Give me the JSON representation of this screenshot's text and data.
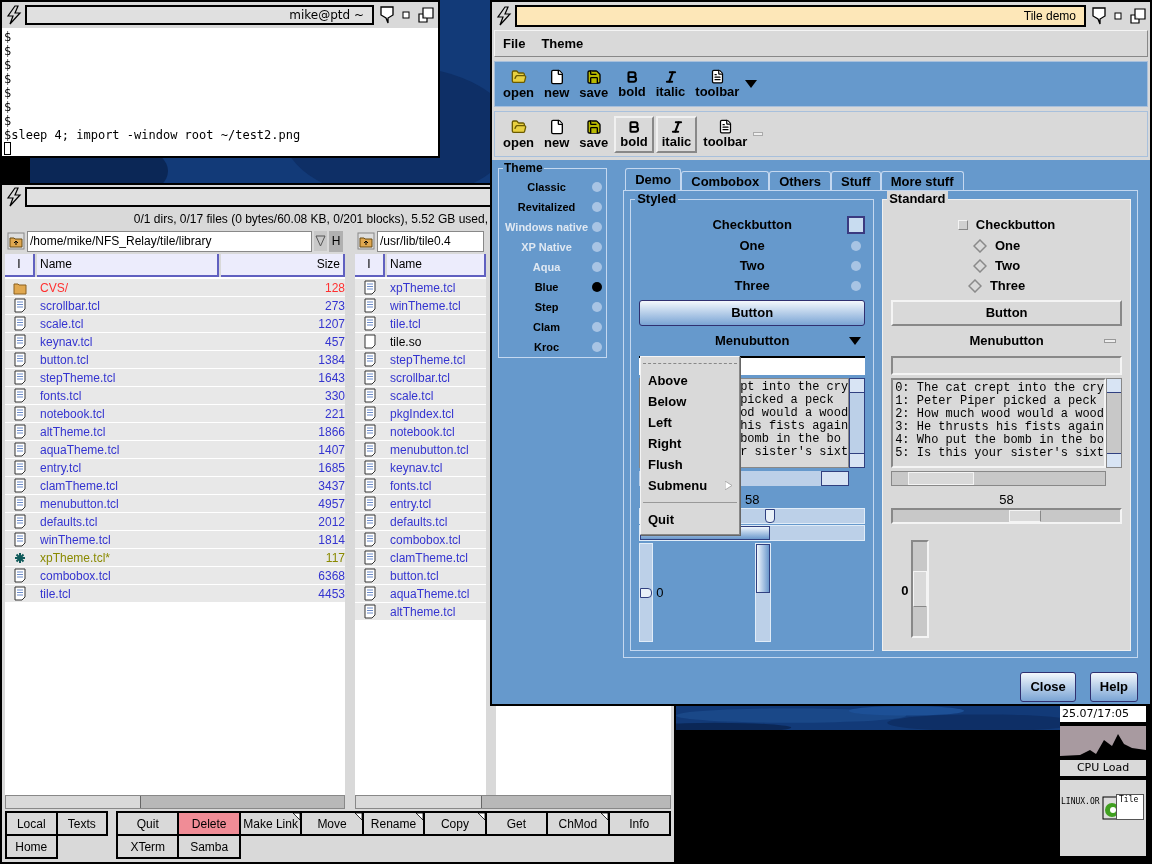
{
  "terminal": {
    "title": "mike@ptd ~",
    "lines": [
      "$",
      "$",
      "$",
      "$",
      "$",
      "$",
      "$",
      "$sleep 4; import -window root ~/test2.png"
    ]
  },
  "file_manager": {
    "status": "0/1 dirs, 0/17 files (0 bytes/60.08 KB, 0/201 blocks), 5.52 GB used,",
    "panes": [
      {
        "path": "/home/mike/NFS_Relay/tile/library",
        "history_button": "H",
        "columns": [
          "I",
          "Name",
          "Size"
        ],
        "files": [
          {
            "name": "CVS/",
            "size": "128",
            "kind": "folder"
          },
          {
            "name": "scrollbar.tcl",
            "size": "273",
            "kind": "file"
          },
          {
            "name": "scale.tcl",
            "size": "1207",
            "kind": "file"
          },
          {
            "name": "keynav.tcl",
            "size": "457",
            "kind": "file"
          },
          {
            "name": "button.tcl",
            "size": "1384",
            "kind": "file"
          },
          {
            "name": "stepTheme.tcl",
            "size": "1643",
            "kind": "file"
          },
          {
            "name": "fonts.tcl",
            "size": "330",
            "kind": "file"
          },
          {
            "name": "notebook.tcl",
            "size": "221",
            "kind": "file"
          },
          {
            "name": "altTheme.tcl",
            "size": "1866",
            "kind": "file"
          },
          {
            "name": "aquaTheme.tcl",
            "size": "1407",
            "kind": "file"
          },
          {
            "name": "entry.tcl",
            "size": "1685",
            "kind": "file"
          },
          {
            "name": "clamTheme.tcl",
            "size": "3437",
            "kind": "file"
          },
          {
            "name": "menubutton.tcl",
            "size": "4957",
            "kind": "file"
          },
          {
            "name": "defaults.tcl",
            "size": "2012",
            "kind": "file"
          },
          {
            "name": "winTheme.tcl",
            "size": "1814",
            "kind": "file"
          },
          {
            "name": "xpTheme.tcl*",
            "size": "117",
            "kind": "modified"
          },
          {
            "name": "combobox.tcl",
            "size": "6368",
            "kind": "file"
          },
          {
            "name": "tile.tcl",
            "size": "4453",
            "kind": "file"
          }
        ]
      },
      {
        "path": "/usr/lib/tile0.4",
        "columns": [
          "I",
          "Name"
        ],
        "files": [
          {
            "name": "xpTheme.tcl",
            "kind": "file"
          },
          {
            "name": "winTheme.tcl",
            "kind": "file"
          },
          {
            "name": "tile.tcl",
            "kind": "file"
          },
          {
            "name": "tile.so",
            "kind": "binary"
          },
          {
            "name": "stepTheme.tcl",
            "kind": "file"
          },
          {
            "name": "scrollbar.tcl",
            "kind": "file"
          },
          {
            "name": "scale.tcl",
            "kind": "file"
          },
          {
            "name": "pkgIndex.tcl",
            "kind": "file"
          },
          {
            "name": "notebook.tcl",
            "kind": "file"
          },
          {
            "name": "menubutton.tcl",
            "kind": "file"
          },
          {
            "name": "keynav.tcl",
            "kind": "file"
          },
          {
            "name": "fonts.tcl",
            "kind": "file"
          },
          {
            "name": "entry.tcl",
            "kind": "file"
          },
          {
            "name": "defaults.tcl",
            "kind": "file"
          },
          {
            "name": "combobox.tcl",
            "kind": "file"
          },
          {
            "name": "clamTheme.tcl",
            "kind": "file"
          },
          {
            "name": "button.tcl",
            "kind": "file"
          },
          {
            "name": "aquaTheme.tcl",
            "kind": "file"
          },
          {
            "name": "altTheme.tcl",
            "kind": "file"
          }
        ]
      }
    ],
    "side_buttons": [
      {
        "label": "Local"
      },
      {
        "label": "Texts"
      },
      {
        "label": "Home"
      }
    ],
    "buttons": [
      {
        "label": "Quit",
        "highlighted": false,
        "has_menu": false
      },
      {
        "label": "Delete",
        "highlighted": true,
        "has_menu": false
      },
      {
        "label": "Make Link",
        "highlighted": false,
        "has_menu": true
      },
      {
        "label": "Move",
        "highlighted": false,
        "has_menu": true
      },
      {
        "label": "Rename",
        "highlighted": false,
        "has_menu": true
      },
      {
        "label": "Copy",
        "highlighted": false,
        "has_menu": true
      },
      {
        "label": "Get",
        "highlighted": false,
        "has_menu": false
      },
      {
        "label": "ChMod",
        "highlighted": false,
        "has_menu": true
      },
      {
        "label": "Info",
        "highlighted": false,
        "has_menu": false
      },
      {
        "label": "XTerm",
        "highlighted": false,
        "has_menu": false
      },
      {
        "label": "Samba",
        "highlighted": false,
        "has_menu": false
      }
    ]
  },
  "tile_demo": {
    "title": "Tile demo",
    "menu": [
      "File",
      "Theme"
    ],
    "toolbars": [
      {
        "items": [
          {
            "label": "open",
            "pressed": false
          },
          {
            "label": "new",
            "pressed": false
          },
          {
            "label": "save",
            "pressed": false
          },
          {
            "label": "bold",
            "pressed": false
          },
          {
            "label": "italic",
            "pressed": false
          },
          {
            "label": "toolbar",
            "pressed": false
          }
        ]
      },
      {
        "items": [
          {
            "label": "open",
            "pressed": false
          },
          {
            "label": "new",
            "pressed": false
          },
          {
            "label": "save",
            "pressed": false
          },
          {
            "label": "bold",
            "pressed": true
          },
          {
            "label": "italic",
            "pressed": true
          },
          {
            "label": "toolbar",
            "pressed": false
          }
        ]
      }
    ],
    "theme_group": {
      "title": "Theme",
      "items": [
        {
          "label": "Classic",
          "selected": false,
          "disabled": false
        },
        {
          "label": "Revitalized",
          "selected": false,
          "disabled": false
        },
        {
          "label": "Windows native",
          "selected": false,
          "disabled": true
        },
        {
          "label": "XP Native",
          "selected": false,
          "disabled": true
        },
        {
          "label": "Aqua",
          "selected": false,
          "disabled": true
        },
        {
          "label": "Blue",
          "selected": true,
          "disabled": false
        },
        {
          "label": "Step",
          "selected": false,
          "disabled": false
        },
        {
          "label": "Clam",
          "selected": false,
          "disabled": false
        },
        {
          "label": "Kroc",
          "selected": false,
          "disabled": false
        }
      ]
    },
    "tabs": [
      {
        "label": "Demo",
        "selected": true
      },
      {
        "label": "Combobox",
        "selected": false
      },
      {
        "label": "Others",
        "selected": false
      },
      {
        "label": "Stuff",
        "selected": false
      },
      {
        "label": "More stuff",
        "selected": false
      }
    ],
    "styled": {
      "title": "Styled",
      "checkbutton": {
        "label": "Checkbutton",
        "checked": false
      },
      "radios": [
        {
          "label": "One",
          "selected": false
        },
        {
          "label": "Two",
          "selected": false
        },
        {
          "label": "Three",
          "selected": false
        }
      ],
      "button": "Button",
      "menubutton": "Menubutton",
      "text_lines": [
        "pt into the cry",
        "picked a peck",
        "od would a wood",
        "his fists again",
        "bomb in the bo",
        "r sister's sixt"
      ],
      "scale": {
        "reading": "58",
        "level": 0.58
      },
      "progress": {
        "level": 0.58
      },
      "vscale": {
        "reading": "0",
        "level": 0.5
      },
      "vprogress": {
        "level": 0.5
      }
    },
    "popup_menu": {
      "items": [
        {
          "label": "Above",
          "kind": "command"
        },
        {
          "label": "Below",
          "kind": "command"
        },
        {
          "label": "Left",
          "kind": "command"
        },
        {
          "label": "Right",
          "kind": "command"
        },
        {
          "label": "Flush",
          "kind": "command"
        },
        {
          "label": "Submenu",
          "kind": "submenu"
        },
        {
          "kind": "separator"
        },
        {
          "label": "Quit",
          "kind": "command"
        }
      ]
    },
    "standard": {
      "title": "Standard",
      "checkbutton": {
        "label": "Checkbutton",
        "checked": false
      },
      "radios": [
        {
          "label": "One",
          "selected": false
        },
        {
          "label": "Two",
          "selected": false
        },
        {
          "label": "Three",
          "selected": false
        }
      ],
      "button": "Button",
      "menubutton": "Menubutton",
      "text_lines": [
        "0: The cat crept into the cry",
        "1: Peter Piper picked a peck",
        "2: How much wood would a wood",
        "3: He thrusts his fists again",
        "4: Who put the bomb in the bo",
        "5: Is this your sister's sixt"
      ],
      "scale": {
        "reading": "58",
        "level": 0.58
      },
      "vscale": {
        "reading": "0",
        "level": 0.5
      }
    },
    "buttons": [
      "Close",
      "Help"
    ]
  },
  "dock": {
    "clock": "25.07/17:05",
    "cpu_label": "CPU Load",
    "app_texts": [
      "LINUX.OR",
      "Tile"
    ]
  }
}
